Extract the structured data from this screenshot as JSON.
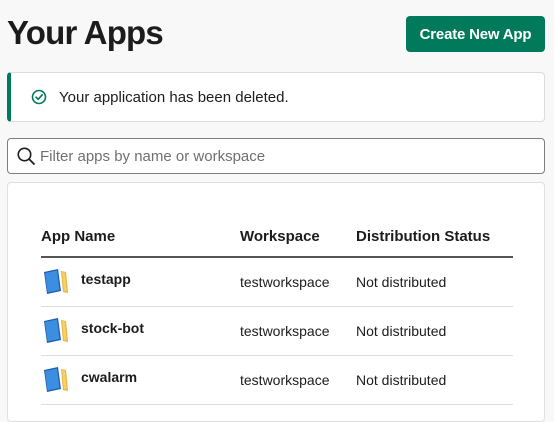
{
  "page": {
    "title": "Your Apps"
  },
  "header": {
    "create_button_label": "Create New App"
  },
  "alert": {
    "message": "Your application has been deleted.",
    "icon": "check-circle-icon",
    "accent": "#007a5a"
  },
  "search": {
    "placeholder": "Filter apps by name or workspace",
    "value": ""
  },
  "table": {
    "headers": {
      "name": "App Name",
      "workspace": "Workspace",
      "status": "Distribution Status"
    },
    "rows": [
      {
        "name": "testapp",
        "workspace": "testworkspace",
        "status": "Not distributed",
        "icon": "app-book-icon"
      },
      {
        "name": "stock-bot",
        "workspace": "testworkspace",
        "status": "Not distributed",
        "icon": "app-book-icon"
      },
      {
        "name": "cwalarm",
        "workspace": "testworkspace",
        "status": "Not distributed",
        "icon": "app-book-icon"
      }
    ]
  },
  "colors": {
    "primary_button": "#007a5a",
    "background": "#f8f8f8"
  }
}
